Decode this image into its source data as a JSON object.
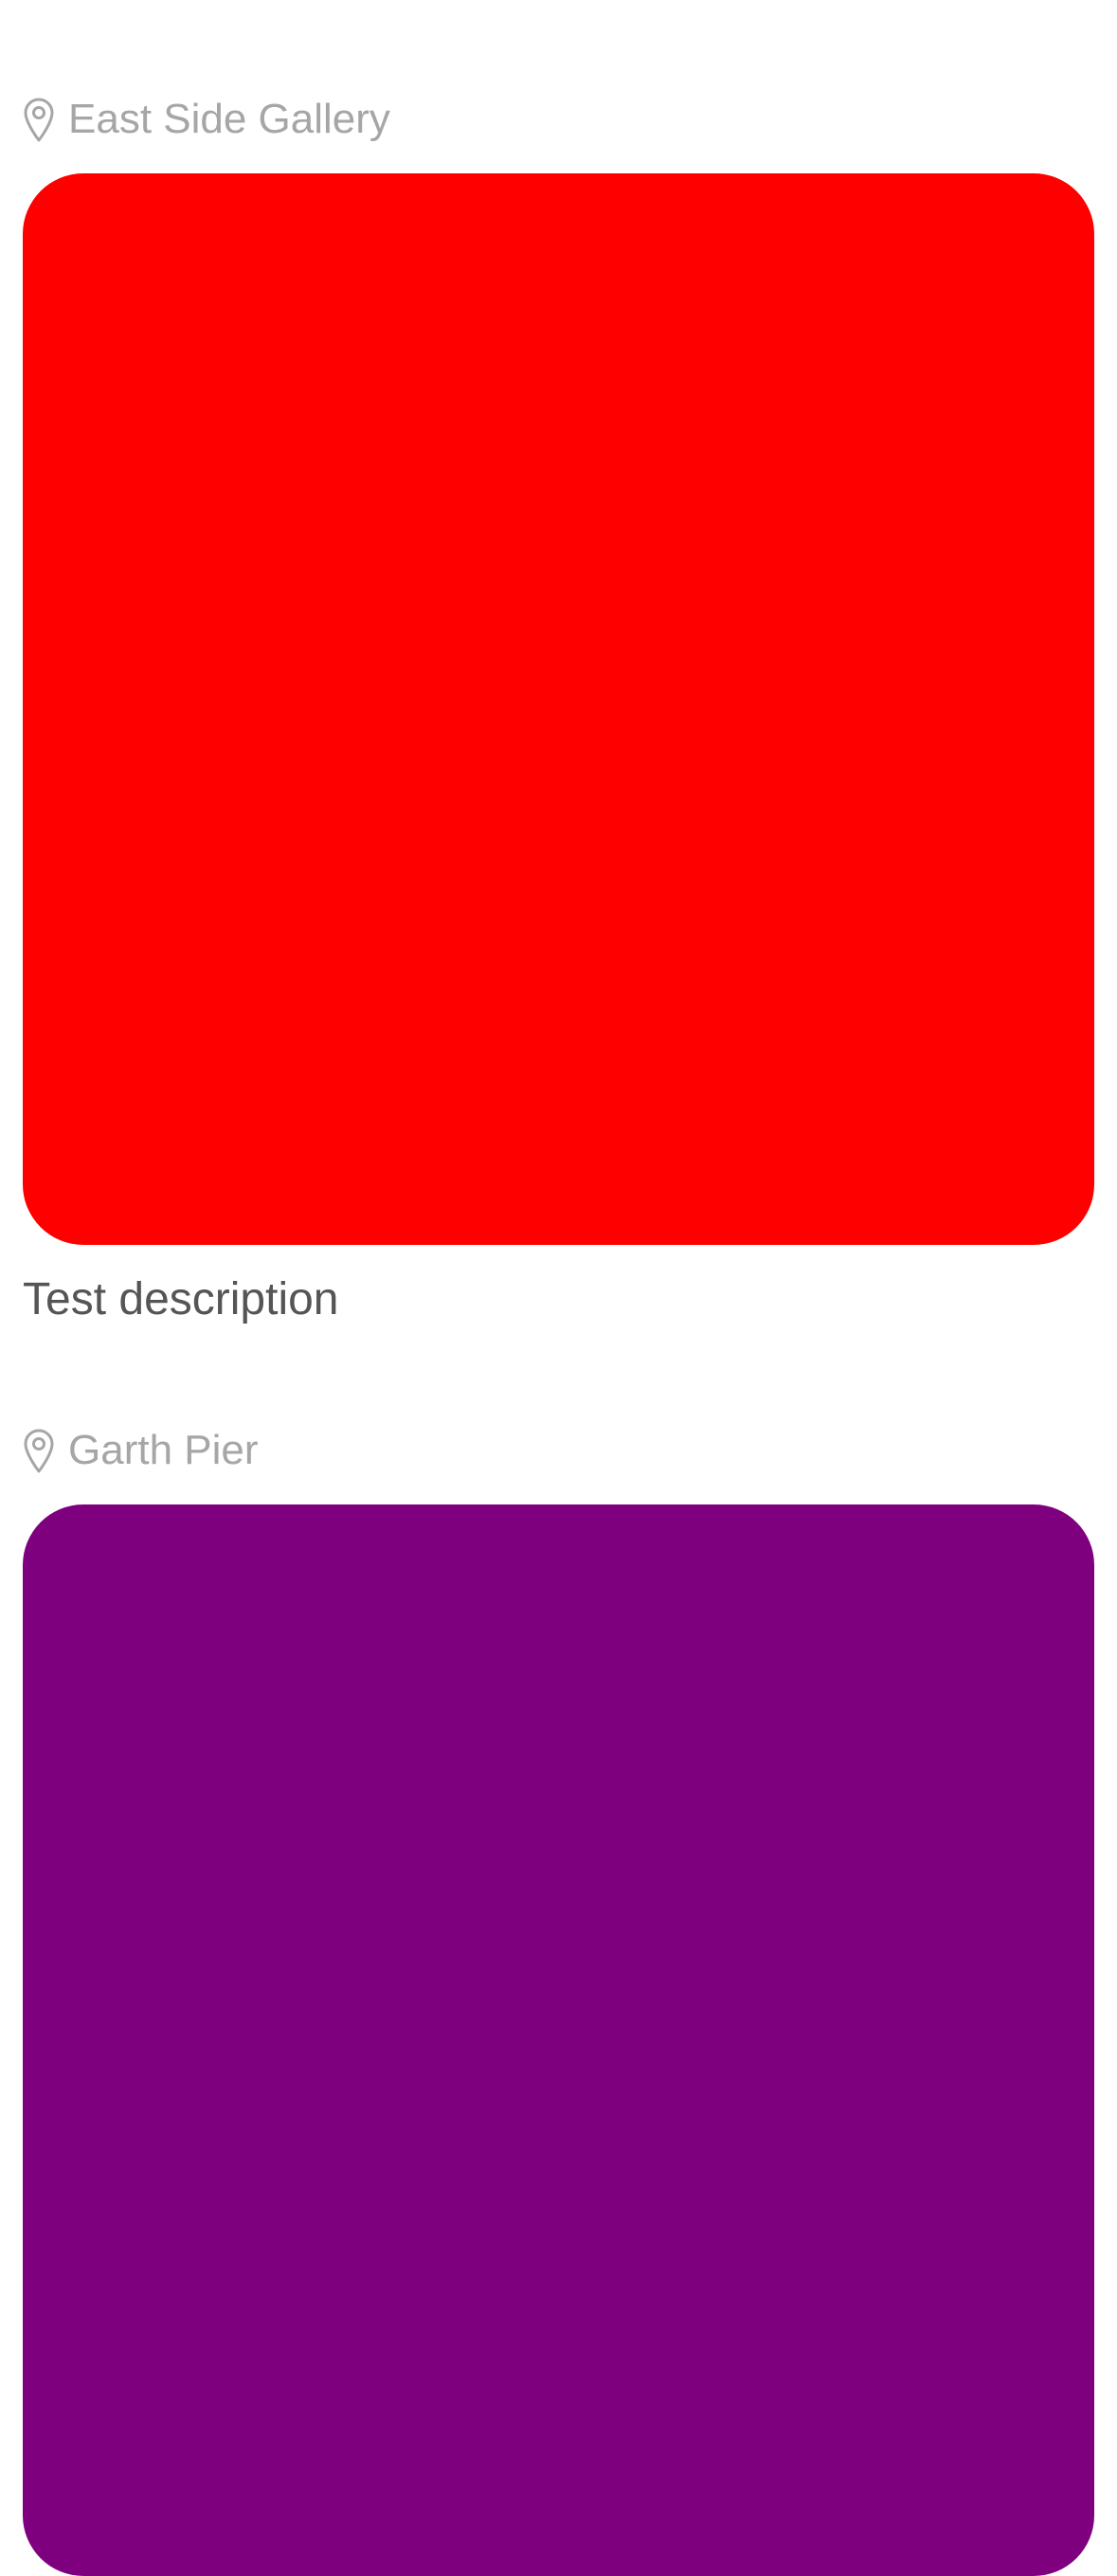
{
  "posts": [
    {
      "location": "East Side Gallery",
      "location_icon": "map-pin-icon",
      "photo_color": "#fe0000",
      "description": "Test description"
    },
    {
      "location": "Garth Pier",
      "location_icon": "map-pin-icon",
      "photo_color": "#7f007f",
      "description": ""
    }
  ],
  "colors": {
    "location_text": "#a6a6a6",
    "description_text": "#555555",
    "background": "#ffffff"
  }
}
